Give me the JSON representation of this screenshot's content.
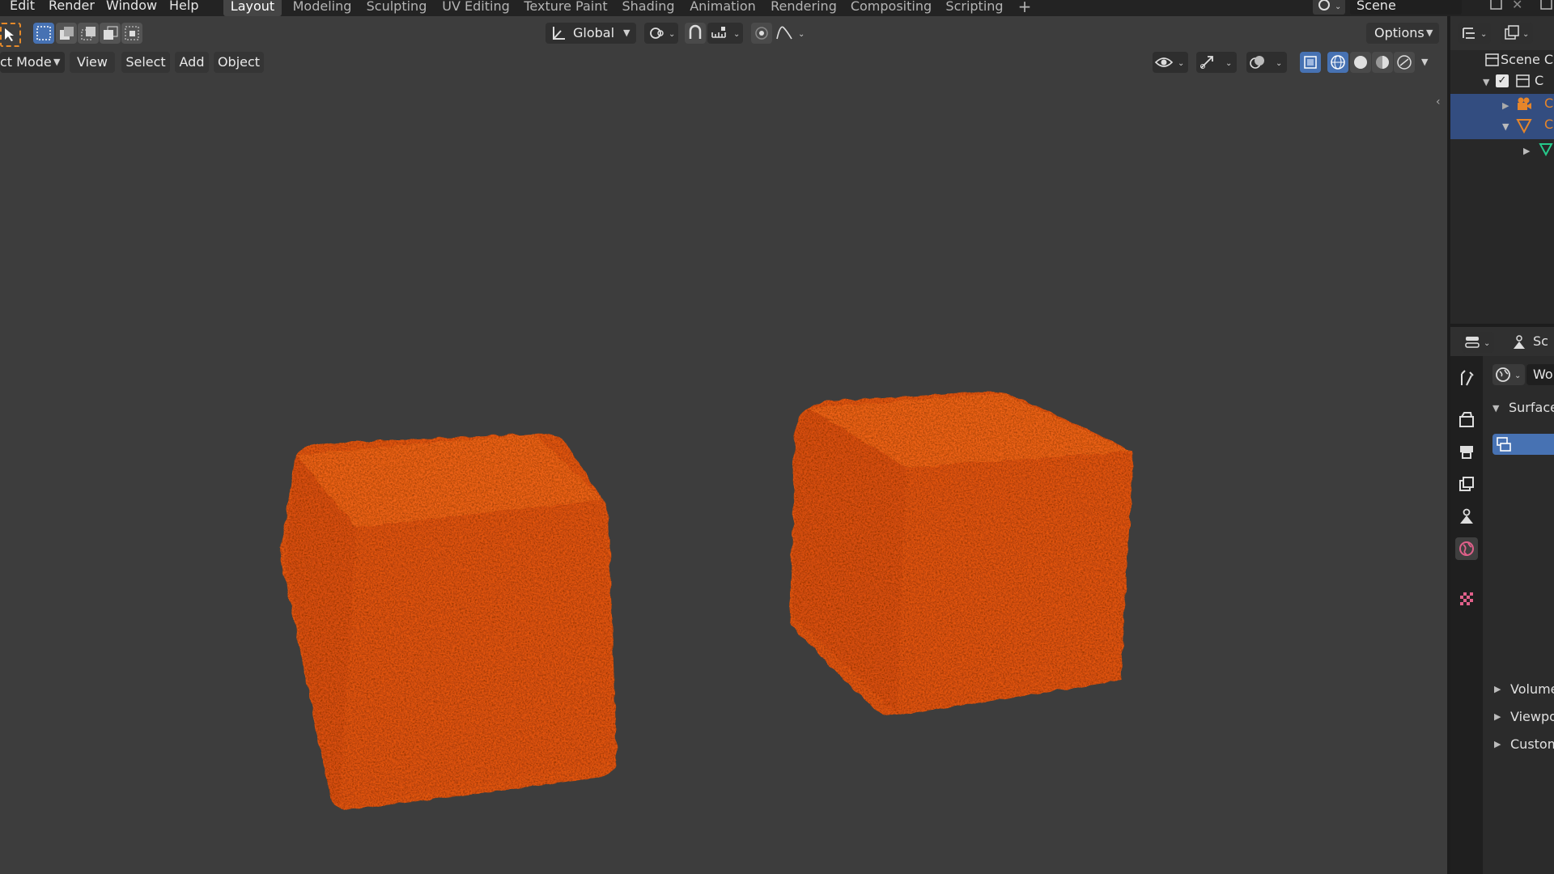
{
  "menu": [
    "Edit",
    "Render",
    "Window",
    "Help"
  ],
  "workspaces": [
    "Layout",
    "Modeling",
    "Sculpting",
    "UV Editing",
    "Texture Paint",
    "Shading",
    "Animation",
    "Rendering",
    "Compositing",
    "Scripting"
  ],
  "scene_name": "Scene",
  "toolbar": {
    "orientation": "Global",
    "options_label": "Options"
  },
  "header": {
    "mode": "ct Mode",
    "menus": [
      "View",
      "Select",
      "Add",
      "Object"
    ]
  },
  "outliner": {
    "root_label": "Scene Co",
    "row_truncated": "C"
  },
  "properties": {
    "scene_tab_label": "Sc",
    "world_field": "Wo",
    "panels": {
      "surface": "Surface",
      "volume": "Volume",
      "viewport": "Viewpo",
      "custom": "Custom"
    }
  },
  "colors": {
    "cube": "#e8580c",
    "selection_blue": "#4772b3",
    "background": "#3d3d3d"
  }
}
